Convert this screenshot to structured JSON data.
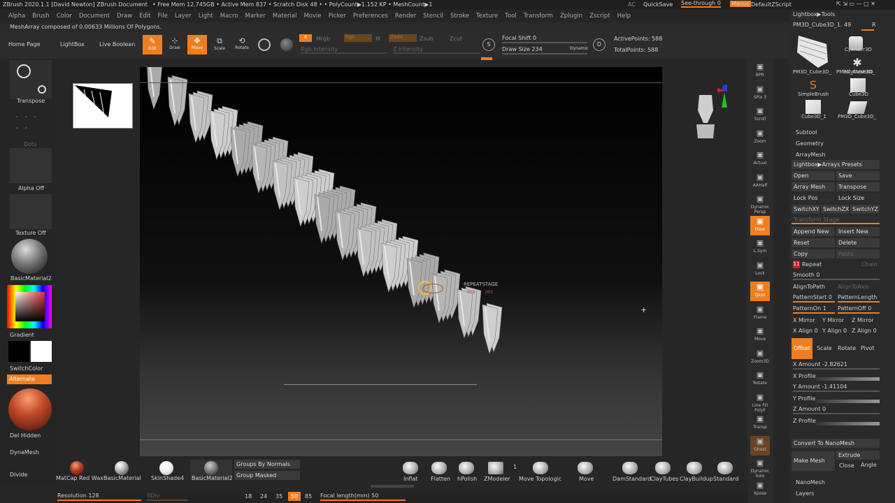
{
  "title": "ZBrush 2020.1.1 [David Newton]  ZBrush Document",
  "mem_info": "• Free Mem 12.745GB • Active Mem 837 • Scratch Disk 48 •  • PolyCount▶1.152 KP  • MeshCount▶1",
  "ac": "AC",
  "quicksave": "QuickSave",
  "see_through": "See-through  0",
  "menus": "Menus",
  "default_zscript": "DefaultZScript",
  "menu": [
    "Alpha",
    "Brush",
    "Color",
    "Document",
    "Draw",
    "Edit",
    "File",
    "Layer",
    "Light",
    "Macro",
    "Marker",
    "Material",
    "Movie",
    "Picker",
    "Preferences",
    "Render",
    "Stencil",
    "Stroke",
    "Texture",
    "Tool",
    "Transform",
    "Zplugin",
    "Zscript",
    "Help"
  ],
  "notice": "MeshArray composed of 0.00633 Millions Of Polygons.",
  "toolbar": {
    "home_page": "Home Page",
    "lightbox": "LightBox",
    "live_boolean": "Live Boolean",
    "edit": "Edit",
    "draw": "Draw",
    "move": "Move",
    "scale": "Scale",
    "rotate": "Rotate",
    "a": "A",
    "mrgb": "Mrgb",
    "rgb": "Rgb",
    "m": "M",
    "zadd": "Zadd",
    "zsub": "Zsub",
    "zcut": "Zcut",
    "rgb_intensity": "Rgb Intensity",
    "z_intensity": "Z Intensity",
    "focal_shift": "Focal Shift 0",
    "draw_size": "Draw Size 234",
    "dynamic": "Dynamic",
    "active_points": "ActivePoints: 588",
    "total_points": "TotalPoints: 588"
  },
  "left": {
    "transpose": "Transpose",
    "dots": "Dots",
    "alpha_off": "Alpha Off",
    "texture_off": "Texture Off",
    "basic_material2": "BasicMaterial2",
    "gradient": "Gradient",
    "switch_color": "SwitchColor",
    "alternate": "Alternate",
    "del_hidden": "Del Hidden",
    "dynamesh": "DynaMesh",
    "divide": "Divide"
  },
  "viewport": {
    "repeat_stage": "REPEATSTAGE",
    "stage_a": "001",
    "stage_b": "001"
  },
  "shelf": [
    "BPR",
    "SPix 3",
    "Scroll",
    "Zoom",
    "Actual",
    "AAHalf",
    "Dynamic Persp",
    "Floor",
    "L.Sym",
    "Lock",
    "Qxyz",
    "Frame",
    "Move",
    "Zoom3D",
    "Rotate",
    "Line Fill PolyF",
    "Transp",
    "Ghost",
    "Dynamic Solo",
    "Xpose"
  ],
  "right": {
    "lightbox_tools": "Lightbox▶Tools",
    "tool_name": "PM3D_Cube3D_1. 49",
    "r": "R",
    "tools": [
      "PM3D_Cube3D_",
      "Cylinder3D",
      "PM3D_Cube3D_",
      "PolyMesh3D",
      "SimpleBrush",
      "Cube3D",
      "Cube3D_1",
      "PM3D_Cube3D_"
    ],
    "subtool": "Subtool",
    "geometry": "Geometry",
    "arraymesh": "ArrayMesh",
    "arrays_presets": "Lightbox▶Arrays Presets",
    "open": "Open",
    "save": "Save",
    "array_mesh": "Array Mesh",
    "transpose": "Transpose",
    "lock_pos": "Lock Pos",
    "lock_size": "Lock Size",
    "switchxy": "SwitchXY",
    "switchzx": "SwitchZX",
    "switchyz": "SwitchYZ",
    "transform_stage": "Transform Stage",
    "append_new": "Append New",
    "insert_new": "Insert New",
    "reset": "Reset",
    "delete": "Delete",
    "copy": "Copy",
    "paste": "Paste",
    "repeat_num": "11",
    "repeat": "Repeat",
    "chain": "Chain",
    "smooth": "Smooth 0",
    "align_to_path": "AlignToPath",
    "align_to_axis": "AlignToAxis",
    "pattern_start": "PatternStart 0",
    "pattern_length": "PatternLength",
    "pattern_on": "PatternOn 1",
    "pattern_off": "PatternOff 0",
    "x_mirror": "X Mirror",
    "y_mirror": "Y Mirror",
    "z_mirror": "Z Mirror",
    "x_align": "X Align 0",
    "y_align": "Y Align 0",
    "z_align": "Z Align 0",
    "offset": "Offset",
    "scale": "Scale",
    "rotate": "Rotate",
    "pivot": "Pivot",
    "x_amount": "X Amount -2.82621",
    "x_profile": "X Profile",
    "y_amount": "Y Amount -1.41104",
    "y_profile": "Y Profile",
    "z_amount": "Z Amount 0",
    "z_profile": "Z Profile",
    "convert_nanomesh": "Convert To NanoMesh",
    "make_mesh": "Make Mesh",
    "extrude": "Extrude",
    "close": "Close",
    "angle": "Angle",
    "nanomesh": "NanoMesh",
    "layers": "Layers"
  },
  "bottom": {
    "materials": [
      "MatCap Red Wax",
      "BasicMaterial",
      "SkinShade4",
      "BasicMaterial2"
    ],
    "groups_by_normals": "Groups By Normals",
    "group_masked": "Group Masked",
    "brushes": [
      "Inflat",
      "Flatten",
      "hPolish",
      "ZModeler",
      "Move Topologic",
      "Move",
      "DamStandard",
      "ClayTubes",
      "ClayBuildup",
      "Standard"
    ],
    "zmodeler_count": "1",
    "resolution": "Resolution 128",
    "sdiv": "SDiv",
    "lens": [
      "18",
      "24",
      "35",
      "50",
      "85"
    ],
    "focal_length": "Focal length(mm) 50"
  },
  "colors": {
    "accent": "#f07d1e",
    "panel": "#2a2a2a",
    "button": "#3a3a3a"
  }
}
